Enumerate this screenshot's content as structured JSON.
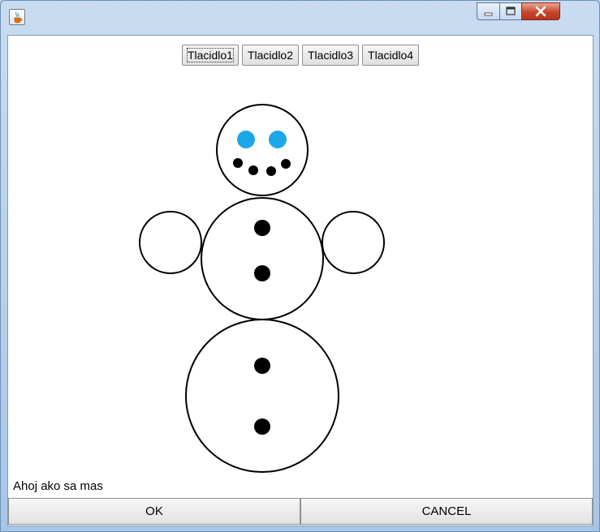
{
  "window": {
    "app_icon": "java-coffee-cup-icon",
    "controls": [
      "minimize-icon",
      "maximize-icon",
      "close-icon"
    ]
  },
  "toolbar": {
    "buttons": [
      "Tlacidlo1",
      "Tlacidlo2",
      "Tlacidlo3",
      "Tlacidlo4"
    ]
  },
  "drawing": {
    "subject": "snowman",
    "eye_color": "#1ea7e8",
    "ink_color": "#000000"
  },
  "status": {
    "text": "Ahoj ako sa mas"
  },
  "footer": {
    "ok_label": "OK",
    "cancel_label": "CANCEL"
  },
  "colors": {
    "titlebar": "#b9d1ea",
    "close_button": "#c8462d"
  }
}
